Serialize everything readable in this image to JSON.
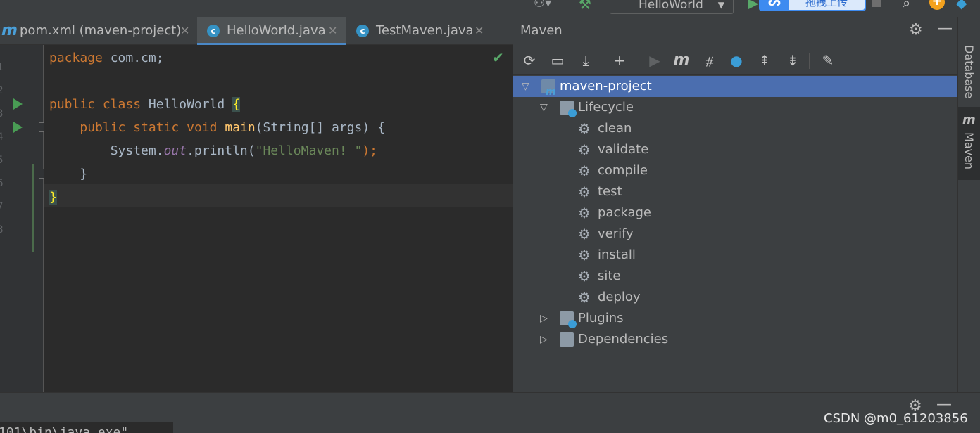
{
  "toolbar": {
    "run_config": "HelloWorld",
    "upload_label": "拖拽上传"
  },
  "tabs": [
    {
      "label": "pom.xml (maven-project)",
      "icon": "maven-icon"
    },
    {
      "label": "HelloWorld.java",
      "icon": "java-class-icon",
      "active": true
    },
    {
      "label": "TestMaven.java",
      "icon": "java-class-icon"
    }
  ],
  "gutter": {
    "line_numbers": [
      "1",
      "2",
      "3",
      "4",
      "5",
      "6",
      "7",
      "8"
    ]
  },
  "code": {
    "line1": {
      "kw": "package",
      "rest": " com.cm;"
    },
    "line3": {
      "kw1": "public",
      "kw2": "class",
      "name": " HelloWorld ",
      "brace": "{"
    },
    "line4": {
      "indent": "    ",
      "kw1": "public",
      "kw2": "static",
      "kw3": "void",
      "fn": "main",
      "rest": "(String[] args) {"
    },
    "line5": {
      "indent": "        ",
      "obj": "System.",
      "field": "out",
      "call": ".println(",
      "str": "\"HelloMaven! \"",
      "end": ");"
    },
    "line6": "    }",
    "line7": "}"
  },
  "maven": {
    "title": "Maven",
    "toolbar_icons": [
      "reload-icon",
      "add-folder-icon",
      "download-icon",
      "plus-icon",
      "run-icon",
      "maven-goal-icon",
      "toggle-offline-icon",
      "skip-tests-icon",
      "expand-all-icon",
      "collapse-all-icon",
      "wrench-icon"
    ],
    "project": "maven-project",
    "lifecycle": "Lifecycle",
    "phases": [
      "clean",
      "validate",
      "compile",
      "test",
      "package",
      "verify",
      "install",
      "site",
      "deploy"
    ],
    "plugins": "Plugins",
    "dependencies": "Dependencies"
  },
  "right_stripe": {
    "database": "Database",
    "maven": "Maven"
  },
  "console": {
    "text": "101\\bin\\java.exe\""
  },
  "watermark": "CSDN @m0_61203856"
}
